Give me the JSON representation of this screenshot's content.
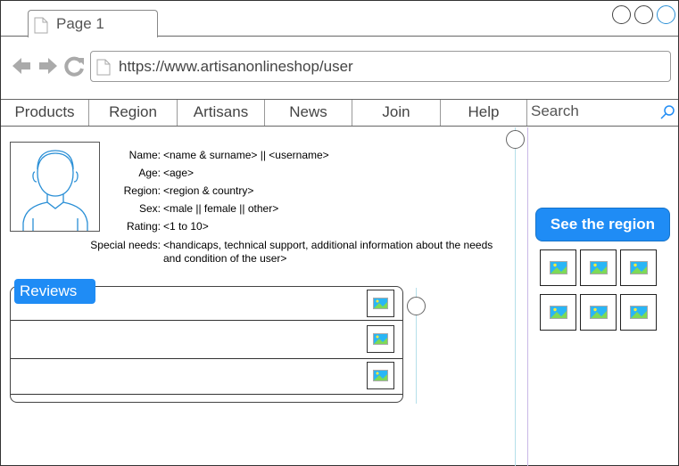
{
  "browser": {
    "tab_title": "Page 1",
    "url": "https://www.artisanonlineshop/user"
  },
  "menu": {
    "items": [
      "Products",
      "Region",
      "Artisans",
      "News",
      "Join",
      "Help"
    ],
    "search_placeholder": "Search"
  },
  "profile": {
    "fields": [
      {
        "label": "Name:",
        "value": "<name & surname> || <username>"
      },
      {
        "label": "Age:",
        "value": "<age>"
      },
      {
        "label": "Region:",
        "value": "<region & country>"
      },
      {
        "label": "Sex:",
        "value": "<male || female || other>"
      },
      {
        "label": "Rating:",
        "value": "<1 to 10>"
      },
      {
        "label": "Special needs:",
        "value": "<handicaps, technical support, additional information about the needs and condition of the user>"
      }
    ]
  },
  "reviews": {
    "tab_label": "Reviews",
    "rows": 3
  },
  "sidebar": {
    "region_button_label": "See the region",
    "gallery_count": 6
  },
  "colors": {
    "accent": "#1f8cf5",
    "close_button": "#2a8fd6"
  }
}
